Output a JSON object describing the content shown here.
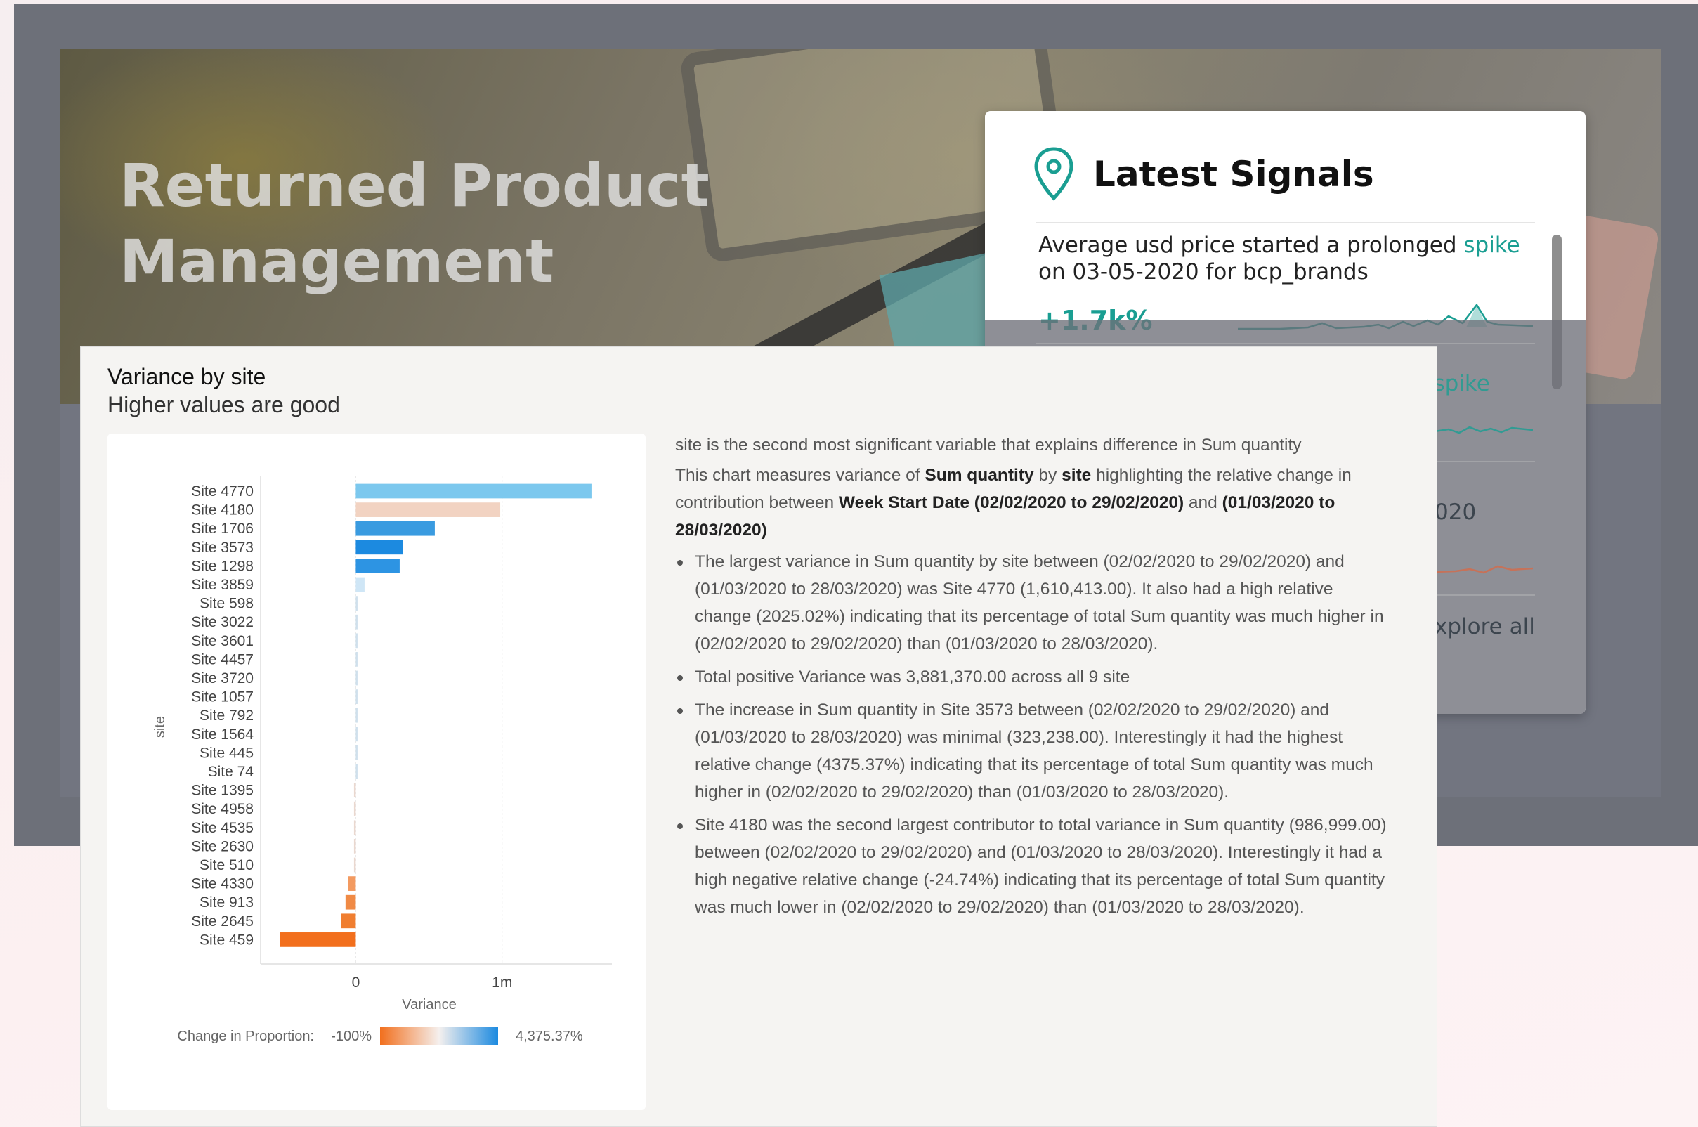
{
  "hero": {
    "title_line1": "Returned Product",
    "title_line2": "Management"
  },
  "signals": {
    "title": "Latest Signals",
    "item1_text_pre": "Average usd price started a prolonged ",
    "item1_text_accent": "spike",
    "item1_text_post": " on 03-05-2020 for bcp_brands",
    "item1_change": "+1.7k%",
    "item2_fragment": "l spike",
    "item3_fragment": "020",
    "explore_fragment": "xplore all",
    "accent_color": "#1a9e92"
  },
  "panel": {
    "title": "Variance by site",
    "subtitle": "Higher values are good"
  },
  "chart_data": {
    "type": "bar",
    "orientation": "horizontal",
    "categories": [
      "Site 4770",
      "Site 4180",
      "Site 1706",
      "Site 3573",
      "Site 1298",
      "Site 3859",
      "Site 598",
      "Site 3022",
      "Site 3601",
      "Site 4457",
      "Site 3720",
      "Site 1057",
      "Site 792",
      "Site 1564",
      "Site 445",
      "Site 74",
      "Site 1395",
      "Site 4958",
      "Site 4535",
      "Site 2630",
      "Site 510",
      "Site 4330",
      "Site 913",
      "Site 2645",
      "Site 459"
    ],
    "values": [
      1610413,
      986999,
      540000,
      323238,
      300000,
      60000,
      8000,
      6000,
      5000,
      4000,
      3500,
      3000,
      2500,
      2000,
      1500,
      1000,
      -1000,
      -1500,
      -2000,
      -3000,
      -5000,
      -50000,
      -70000,
      -100000,
      -520000
    ],
    "colors": [
      "#7cc8ee",
      "#f2d3c2",
      "#3a9be0",
      "#1c8ae0",
      "#2d94e3",
      "#cfe6f6",
      "#cfe0ec",
      "#cfe0ec",
      "#cfe0ec",
      "#cfe0ec",
      "#cfe0ec",
      "#cfe0ec",
      "#cfe0ec",
      "#cfe0ec",
      "#cfe0ec",
      "#cfe0ec",
      "#ead8cf",
      "#ead8cf",
      "#ead8cf",
      "#ead8cf",
      "#ead8cf",
      "#f39a60",
      "#f08a45",
      "#f07e30",
      "#f26f1d"
    ],
    "xlabel": "Variance",
    "ylabel": "site",
    "xticks": [
      {
        "value": 0,
        "label": "0"
      },
      {
        "value": 1000000,
        "label": "1m"
      }
    ],
    "xlim": [
      -650000,
      1750000
    ],
    "legend": {
      "label": "Change in Proportion:",
      "min_label": "-100%",
      "max_label": "4,375.37%",
      "min_color": "#f26f1d",
      "mid_color": "#f5f0ee",
      "max_color": "#1c8ae0"
    },
    "grid": true
  },
  "insights": {
    "intro": "site is the second most significant variable that explains difference in Sum quantity",
    "desc_1": "This chart measures variance of ",
    "desc_b1": "Sum quantity",
    "desc_2": " by ",
    "desc_b2": "site",
    "desc_3": " highlighting the relative change in contribution between ",
    "desc_b3": "Week Start Date (02/02/2020 to 29/02/2020)",
    "desc_4": " and ",
    "desc_b4": "(01/03/2020 to 28/03/2020)",
    "bullets": [
      "The largest variance in Sum quantity by site between (02/02/2020 to 29/02/2020) and (01/03/2020 to 28/03/2020) was Site 4770 (1,610,413.00). It also had a high relative change (2025.02%) indicating that its percentage of total Sum quantity was much higher in (02/02/2020 to 29/02/2020) than (01/03/2020 to 28/03/2020).",
      "Total positive Variance was 3,881,370.00 across all 9 site",
      "The increase in Sum quantity in Site 3573 between (02/02/2020 to 29/02/2020) and (01/03/2020 to 28/03/2020) was minimal (323,238.00). Interestingly it had the highest relative change (4375.37%) indicating that its percentage of total Sum quantity was much higher in (02/02/2020 to 29/02/2020) than (01/03/2020 to 28/03/2020).",
      "Site 4180 was the second largest contributor to total variance in Sum quantity (986,999.00) between (02/02/2020 to 29/02/2020) and (01/03/2020 to 28/03/2020). Interestingly it had a high negative relative change (-24.74%) indicating that its percentage of total Sum quantity was much lower in (02/02/2020 to 29/02/2020) than (01/03/2020 to 28/03/2020)."
    ]
  }
}
